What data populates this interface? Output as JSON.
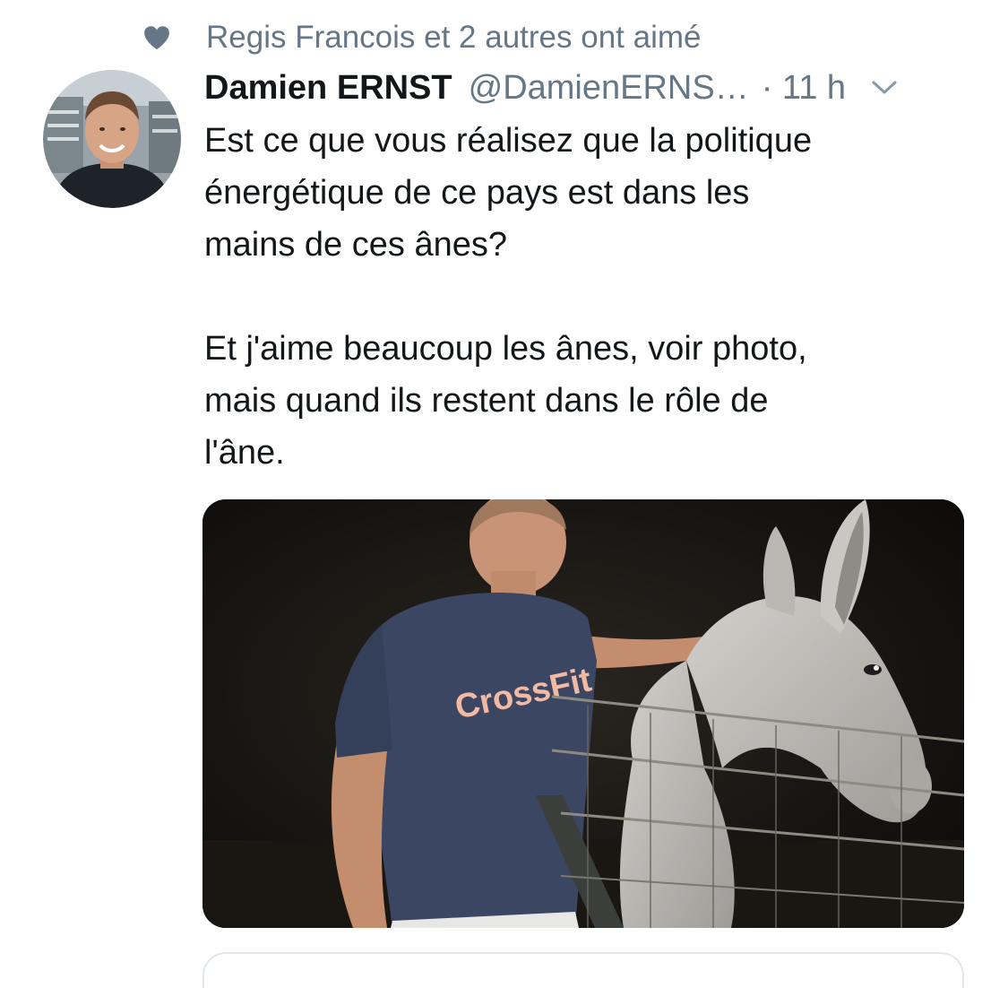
{
  "social_context": {
    "icon": "heart-icon",
    "text": "Regis Francois et 2 autres ont aimé"
  },
  "tweet": {
    "author_name": "Damien ERNST",
    "author_handle": "@DamienERNS…",
    "timestamp": "· 11 h",
    "text": "Est ce que vous réalisez que la politique\nénergétique de ce pays est dans les\nmains de ces ânes?\n\nEt j'aime beaucoup les ânes, voir photo,\nmais quand ils restent dans le rôle de\nl'âne.",
    "media": {
      "shirt_text": "CrossFit"
    }
  },
  "colors": {
    "secondary_text": "#657786",
    "primary_text": "#14171a",
    "border": "#e1e8ed"
  }
}
